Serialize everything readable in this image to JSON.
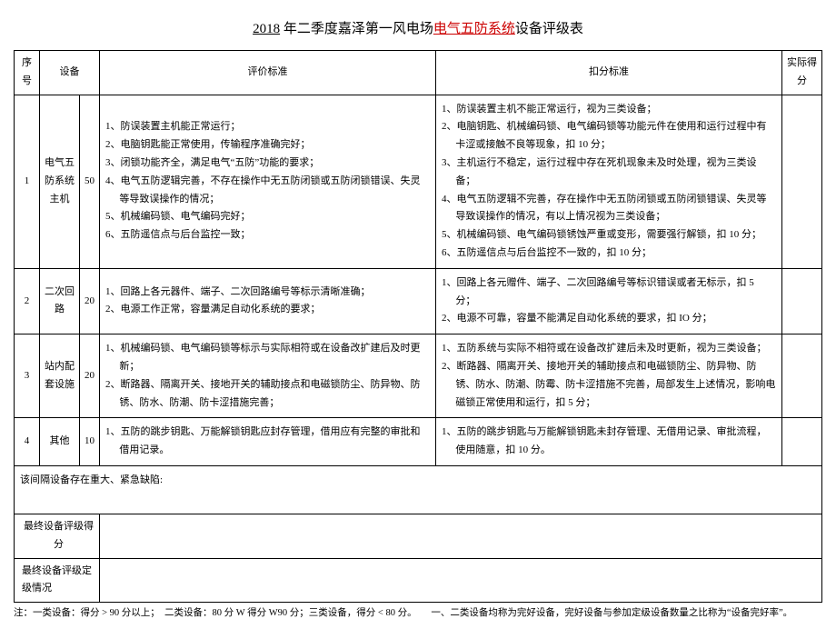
{
  "title": {
    "full_display": "2018 年二季度嘉泽第一风电场电气五防系统设备评级表",
    "underline_part": "2018",
    "after_underline": " 年二季度嘉泽第一风电场",
    "red_part": "电气五防系统",
    "suffix": "设备评级表"
  },
  "headers": {
    "index": "序号",
    "device": "设备",
    "eval": "评价标准",
    "deduct": "扣分标准",
    "actual": "实际得分"
  },
  "rows": [
    {
      "index": "1",
      "device": "电气五防系统主机",
      "score": "50",
      "eval": [
        "1、防误装置主机能正常运行；",
        "2、电脑钥匙能正常使用，传输程序准确完好；",
        "3、闭锁功能齐全，满足电气“五防”功能的要求；",
        "4、电气五防逻辑完善，不存在操作中无五防闭锁或五防闭锁错误、失灵等导致误操作的情况；",
        "5、机械编码锁、电气编码完好；",
        "6、五防遥信点与后台监控一致；"
      ],
      "deduct": [
        "1、防误装置主机不能正常运行，视为三类设备；",
        "2、电脑钥匙、机械编码锁、电气编码锁等功能元件在使用和运行过程中有卡涩或接触不良等现象，扣 10 分；",
        "3、主机运行不稳定，运行过程中存在死机现象未及时处理，视为三类设备；",
        "4、电气五防逻辑不完善，存在操作中无五防闭锁或五防闭锁错误、失灵等导致误操作的情况，有以上情况视为三类设备；",
        "5、机械编码锁、电气编码锁锈蚀严重或变形，需要强行解锁，扣 10 分；",
        "6、五防遥信点与后台监控不一致的，扣 10 分；"
      ]
    },
    {
      "index": "2",
      "device": "二次回路",
      "score": "20",
      "eval": [
        "1、回路上各元器件、端子、二次回路编号等标示清晰准确；",
        "2、电源工作正常，容量满足自动化系统的要求；"
      ],
      "deduct": [
        "1、回路上各元赠件、端子、二次回路编号等标识错误或者无标示，扣 5 分；",
        "2、电源不可靠，容量不能满足自动化系统的要求，扣 IO 分；"
      ]
    },
    {
      "index": "3",
      "device": "站内配套设施",
      "score": "20",
      "eval": [
        "1、机械编码锁、电气编码锁等标示与实际相符或在设备改扩建后及时更新；",
        "2、断路器、隔离开关、接地开关的辅助接点和电磁锁防尘、防异物、防锈、防水、防潮、防卡涩措施完善；"
      ],
      "deduct": [
        "1、五防系统与实际不相符或在设备改扩建后未及时更新，视为三类设备；",
        "2、断路器、隔离开关、接地开关的辅助接点和电磁锁防尘、防异物、防锈、防水、防潮、防霉、防卡涩措施不完善，局部发生上述情况，影响电磁锁正常使用和运行，扣 5 分；"
      ]
    },
    {
      "index": "4",
      "device": "其他",
      "score": "10",
      "eval": [
        "1、五防的跳步钥匙、万能解锁钥匙应封存管理，借用应有完整的审批和借用记录。"
      ],
      "deduct": [
        "1、五防的跳步钥匙与万能解锁钥匙未封存管理、无借用记录、审批流程，使用随意，扣 10 分。"
      ]
    }
  ],
  "defect_text": "该间隔设备存在重大、紧急缺陷:",
  "summary": {
    "final_score_label": "最终设备评级得分",
    "final_class_label": "最终设备评级定级情况"
  },
  "footnote": "注：一类设备：得分 > 90 分以上；　二类设备：80 分 W 得分 W90 分；三类设备，得分 < 80 分。　　一、二类设备均称为完好设备，完好设备与参加定级设备数量之比称为“设备完好率”。"
}
